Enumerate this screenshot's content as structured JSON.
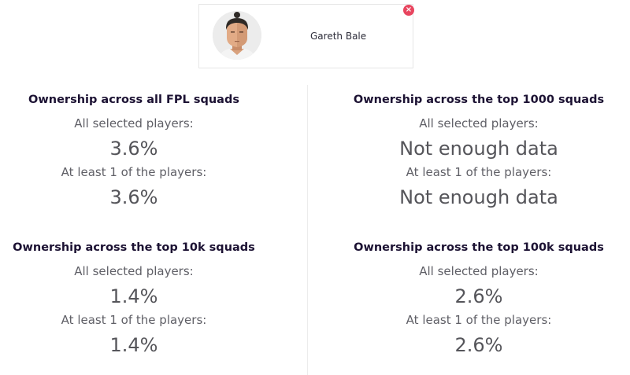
{
  "player": {
    "name": "Gareth Bale",
    "remove_icon": "×"
  },
  "sections": [
    {
      "title": "Ownership across all FPL squads",
      "all_label": "All selected players:",
      "all_value": "3.6%",
      "atleast_label": "At least 1 of the players:",
      "atleast_value": "3.6%"
    },
    {
      "title": "Ownership across the top 1000 squads",
      "all_label": "All selected players:",
      "all_value": "Not enough data",
      "atleast_label": "At least 1 of the players:",
      "atleast_value": "Not enough data"
    },
    {
      "title": "Ownership across the top 10k squads",
      "all_label": "All selected players:",
      "all_value": "1.4%",
      "atleast_label": "At least 1 of the players:",
      "atleast_value": "1.4%"
    },
    {
      "title": "Ownership across the top 100k squads",
      "all_label": "All selected players:",
      "all_value": "2.6%",
      "atleast_label": "At least 1 of the players:",
      "atleast_value": "2.6%"
    }
  ],
  "colors": {
    "title": "#1c1233",
    "label": "#5f5f66",
    "value": "#55555a",
    "remove": "#e8455f"
  }
}
